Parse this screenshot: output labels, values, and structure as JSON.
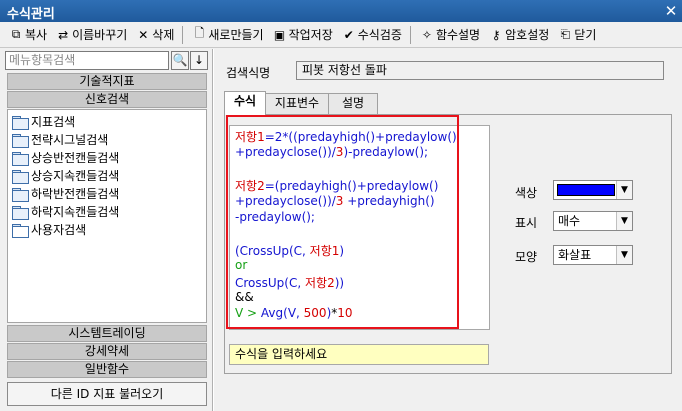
{
  "window": {
    "title": "수식관리",
    "close": "✕"
  },
  "toolbar": {
    "copy": "복사",
    "rename": "이름바꾸기",
    "delete": "삭제",
    "new": "새로만들기",
    "save": "작업저장",
    "verify": "수식검증",
    "func_help": "함수설명",
    "password": "암호설정",
    "close": "닫기"
  },
  "left": {
    "search_placeholder": "메뉴항목검색",
    "search_btn": "🔍",
    "down_btn": "↓",
    "groups_top": [
      "기술적지표",
      "신호검색"
    ],
    "tree_items": [
      "지표검색",
      "전략시그널검색",
      "상승반전캔들검색",
      "상승지속캔들검색",
      "하락반전캔들검색",
      "하락지속캔들검색",
      "사용자검색"
    ],
    "groups_bottom": [
      "시스템트레이딩",
      "강세약세",
      "일반함수"
    ],
    "load_other": "다른 ID 지표 불러오기"
  },
  "right": {
    "name_label": "검색식명",
    "name_value": "피봇 저항선 돌파",
    "tabs": [
      "수식",
      "지표변수",
      "설명"
    ],
    "formula_lines": [
      "저항1=2*((predayhigh()+predaylow()",
      "+predayclose())/3)-predaylow();",
      "",
      "저항2=(predayhigh()+predaylow()",
      "+predayclose())/3 +predayhigh()",
      "-predaylow();",
      "",
      "(CrossUp(C, 저항1)",
      "or",
      "CrossUp(C, 저항2))",
      "&&",
      "V > Avg(V, 500)*10"
    ],
    "hint": "수식을 입력하세요",
    "color_label": "색상",
    "color_value": "#0000ff",
    "display_label": "표시",
    "display_value": "매수",
    "shape_label": "모양",
    "shape_value": "화살표"
  }
}
